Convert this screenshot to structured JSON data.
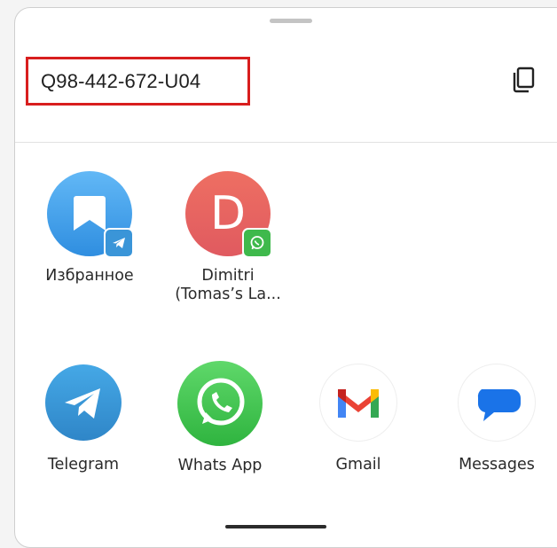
{
  "share_sheet": {
    "code": "Q98-442-672-U04",
    "copy_icon": "copy-icon",
    "direct_targets": [
      {
        "label": "Избранное",
        "icon": "bookmark-icon",
        "badge": "telegram-badge-icon",
        "color": "#3d9bea"
      },
      {
        "label": "Dimitri\n(Tomas’s La...",
        "initial": "D",
        "badge": "whatsapp-badge-icon",
        "color": "#e8615e"
      }
    ],
    "apps": [
      {
        "label": "Telegram",
        "icon": "telegram-icon",
        "color": "#3a95d8"
      },
      {
        "label": "Whats App",
        "icon": "whatsapp-icon",
        "color": "#45c554"
      },
      {
        "label": "Gmail",
        "icon": "gmail-icon"
      },
      {
        "label": "Messages",
        "icon": "messages-icon",
        "color": "#1a73e8"
      }
    ]
  }
}
